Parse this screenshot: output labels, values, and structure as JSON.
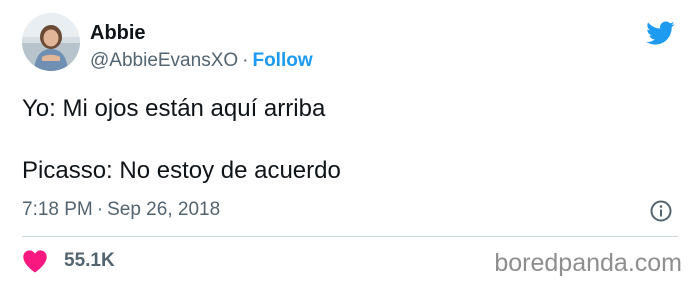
{
  "author": {
    "name": "Abbie",
    "handle": "@AbbieEvansXO",
    "separator": "·",
    "follow_label": "Follow"
  },
  "tweet": {
    "lines": [
      "Yo: Mi ojos están aquí arriba",
      "Picasso: No estoy de acuerdo"
    ],
    "time": "7:18 PM",
    "separator": "·",
    "date": "Sep 26, 2018"
  },
  "engagement": {
    "likes": "55.1K"
  },
  "watermark": "boredpanda.com",
  "icons": {
    "brand": "twitter-bird-icon",
    "info": "info-icon",
    "like": "heart-icon"
  },
  "colors": {
    "accent": "#1d9bf0",
    "heart": "#f91880",
    "text": "#0f1419",
    "secondary_text": "#536471",
    "divider": "#cfd9de",
    "watermark": "#8e8e8e"
  }
}
